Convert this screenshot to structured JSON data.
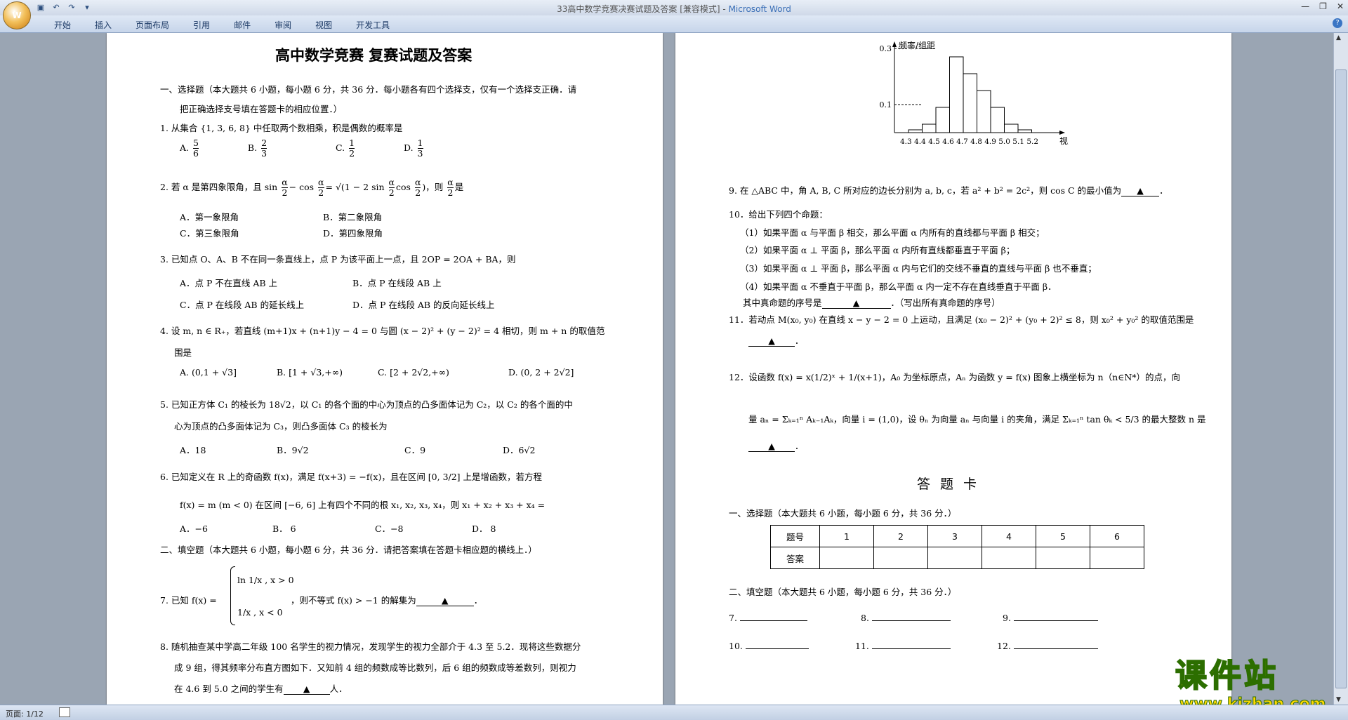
{
  "window": {
    "title_doc": "33高中数学竞赛决赛试题及答案 [兼容模式] - ",
    "title_app": "Microsoft Word"
  },
  "ribbon_tabs": [
    "开始",
    "插入",
    "页面布局",
    "引用",
    "邮件",
    "审阅",
    "视图",
    "开发工具"
  ],
  "office_logo": "W",
  "status": {
    "page": "页面: 1/12"
  },
  "watermark": {
    "line1": "课件站",
    "line2": "www.kjzhan.com"
  },
  "left_page": {
    "title": "高中数学竞赛  复赛试题及答案",
    "sec1_line1": "一、选择题（本大题共 6 小题，每小题 6 分，共 36 分．每小题各有四个选择支，仅有一个选择支正确．请",
    "sec1_line2": "把正确选择支号填在答题卡的相应位置．）",
    "q1": "1. 从集合 {1, 3, 6, 8} 中任取两个数相乘，积是偶数的概率是",
    "q1_opts": {
      "a": "A.",
      "a_num": "5",
      "a_den": "6",
      "b": "B.",
      "b_num": "2",
      "b_den": "3",
      "c": "C.",
      "c_num": "1",
      "c_den": "2",
      "d": "D.",
      "d_num": "1",
      "d_den": "3"
    },
    "q2_pre": "2. 若 α 是第四象限角，且 sin",
    "q2_f1n": "α",
    "q2_f1d": "2",
    "q2_mid1": "− cos",
    "q2_f2n": "α",
    "q2_f2d": "2",
    "q2_mid2": "= √(1 − 2 sin",
    "q2_f3n": "α",
    "q2_f3d": "2",
    "q2_mid3": "cos",
    "q2_f4n": "α",
    "q2_f4d": "2",
    "q2_mid4": ")，则",
    "q2_f5n": "α",
    "q2_f5d": "2",
    "q2_end": "是",
    "q2_a": "A．第一象限角",
    "q2_b": "B．第二象限角",
    "q2_c": "C．第三象限角",
    "q2_d": "D．第四象限角",
    "q3": "3. 已知点 O、A、B 不在同一条直线上，点 P 为该平面上一点，且 2OP = 2OA + BA，则",
    "q3_a": "A．点 P 不在直线 AB 上",
    "q3_b": "B．点 P 在线段 AB 上",
    "q3_c": "C．点 P 在线段 AB 的延长线上",
    "q3_d": "D．点 P 在线段 AB 的反向延长线上",
    "q4_1": "4. 设 m, n ∈ R₊，若直线 (m+1)x + (n+1)y − 4 = 0 与圆 (x − 2)² + (y − 2)² = 4 相切，则 m + n 的取值范",
    "q4_2": "围是",
    "q4_a": "A. (0,1 + √3]",
    "q4_b": "B. [1 + √3,+∞)",
    "q4_c": "C.  [2 + 2√2,+∞)",
    "q4_d": "D. (0, 2 + 2√2]",
    "q5_1": "5.  已知正方体 C₁ 的棱长为 18√2，以 C₁ 的各个面的中心为顶点的凸多面体记为 C₂，以 C₂ 的各个面的中",
    "q5_2": "心为顶点的凸多面体记为 C₃，则凸多面体 C₃ 的棱长为",
    "q5_a": "A．18",
    "q5_b": "B．9√2",
    "q5_c": "C．9",
    "q5_d": "D．6√2",
    "q6_1": "6.  已知定义在 R 上的奇函数 f(x)，满足 f(x+3) = −f(x)，且在区间 [0, 3/2] 上是增函数，若方程",
    "q6_2": "f(x) = m (m < 0) 在区间 [−6, 6] 上有四个不同的根 x₁, x₂, x₃, x₄，则 x₁ + x₂ + x₃ + x₄ =",
    "q6_a": "A．−6",
    "q6_b": "B．  6",
    "q6_c": "C．−8",
    "q6_d": "D．  8",
    "sec2": "二、填空题（本大题共 6 小题，每小题 6 分，共 36 分．请把答案填在答题卡相应题的横线上．）",
    "q7_pre": "7.  已知 f(x) =",
    "q7_case1": "ln 1/x , x > 0",
    "q7_case2": "1/x , x < 0",
    "q7_post": "，则不等式 f(x) > −1 的解集为",
    "q7_blank": "▲",
    "q8_1": "8.  随机抽查某中学高二年级 100 名学生的视力情况，发现学生的视力全部介于 4.3 至 5.2．现将这些数据分",
    "q8_2": "成 9 组，得其频率分布直方图如下．又知前 4 组的频数成等比数列，后 6 组的频数成等差数列，则视力",
    "q8_3": "在 4.6 到 5.0 之间的学生有",
    "q8_blank": "▲",
    "q8_end": "人．"
  },
  "chart_data": {
    "type": "bar",
    "ylabel": "频率/组距",
    "xlabel": "视力",
    "categories": [
      "4.3",
      "4.4",
      "4.5",
      "4.6",
      "4.7",
      "4.8",
      "4.9",
      "5.0",
      "5.1",
      "5.2"
    ],
    "ytick_labels": [
      "0.1",
      "0.3"
    ],
    "values": [
      0.1,
      0.3,
      0.9,
      2.7,
      2.1,
      1.5,
      0.9,
      0.3,
      0.1,
      0.0
    ],
    "ylim": [
      0,
      2.9
    ],
    "x_tick_text": "4.3 4.4 4.5 4.6 4.7 4.8 4.9 5.0 5.1  5.2"
  },
  "right_page": {
    "q9": "9. 在 △ABC 中，角 A, B, C 所对应的边长分别为 a, b, c，若 a² + b² = 2c²，则 cos C 的最小值为",
    "q9_blank": "▲",
    "q10": "10．给出下列四个命题：",
    "q10_1": "（1）如果平面 α 与平面 β 相交，那么平面 α 内所有的直线都与平面 β 相交；",
    "q10_2": "（2）如果平面 α ⊥ 平面 β，那么平面 α 内所有直线都垂直于平面 β；",
    "q10_3": "（3）如果平面 α ⊥ 平面 β，那么平面 α 内与它们的交线不垂直的直线与平面 β 也不垂直；",
    "q10_4": "（4）如果平面 α 不垂直于平面 β，那么平面 α 内一定不存在直线垂直于平面 β．",
    "q10_5": "其中真命题的序号是",
    "q10_blank": "▲",
    "q10_6": "．（写出所有真命题的序号）",
    "q11_1": "11．若动点 M(x₀, y₀) 在直线 x − y − 2 = 0 上运动，且满足 (x₀ − 2)² + (y₀ + 2)² ≤ 8，则 x₀² + y₀² 的取值范围是",
    "q11_blank": "▲",
    "q12_1": "12．设函数 f(x) = x(1/2)ˣ + 1/(x+1)，A₀ 为坐标原点，Aₙ 为函数 y = f(x) 图象上横坐标为 n（n∈N*）的点，向",
    "q12_2": "量 aₙ = Σₖ₌₁ⁿ Aₖ₋₁Aₖ，向量 i = (1,0)，设 θₙ 为向量 aₙ 与向量 i 的夹角，满足 Σₖ₌₁ⁿ tan θₖ < 5/3 的最大整数 n 是",
    "q12_blank": "▲",
    "card_title": "答题卡",
    "card_sec1": "一、选择题（本大题共 6 小题，每小题 6 分，共 36 分．）",
    "card_row1": [
      "题号",
      "1",
      "2",
      "3",
      "4",
      "5",
      "6"
    ],
    "card_row2": [
      "答案",
      "",
      "",
      "",
      "",
      "",
      ""
    ],
    "card_sec2": "二、填空题（本大题共 6 小题，每小题 6 分，共 36 分．）",
    "blank_labels": [
      "7.",
      "8.",
      "9.",
      "10.",
      "11.",
      "12."
    ]
  }
}
